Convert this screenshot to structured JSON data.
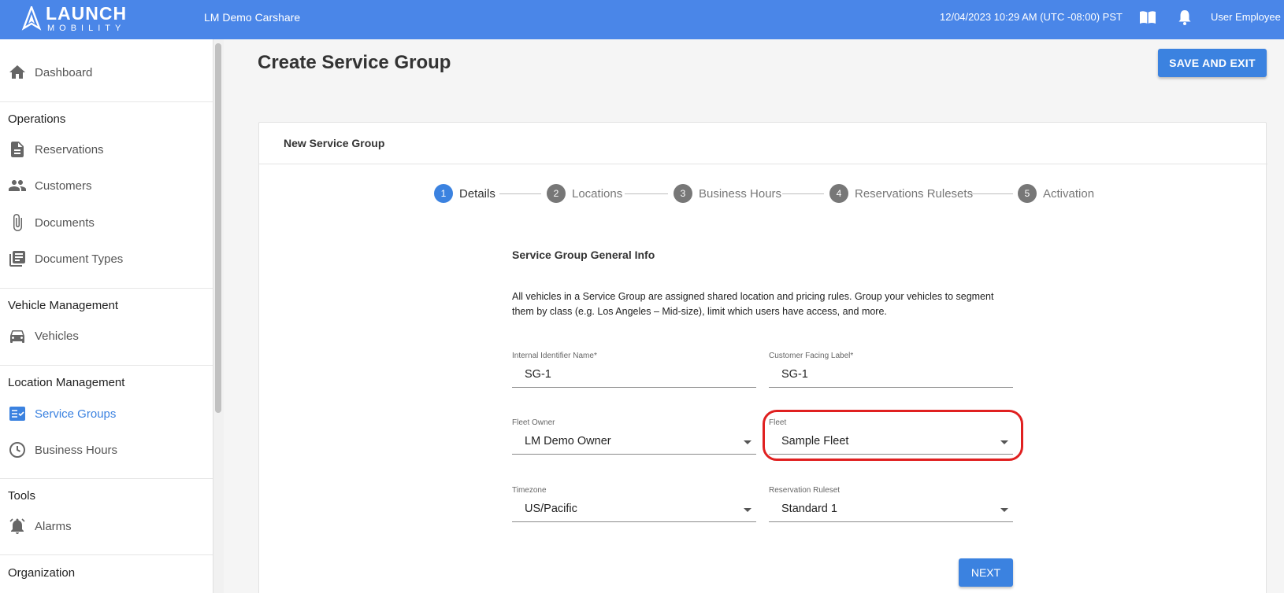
{
  "topbar": {
    "logo_word": "LAUNCH",
    "logo_sub": "MOBILITY",
    "app_name": "LM Demo Carshare",
    "datetime": "12/04/2023 10:29 AM (UTC -08:00) PST",
    "user_name": "User Employee",
    "icons": [
      "book-icon",
      "bell-icon"
    ]
  },
  "sidebar": {
    "dashboard": "Dashboard",
    "sections": {
      "operations": "Operations",
      "vehicle_management": "Vehicle Management",
      "location_management": "Location Management",
      "tools": "Tools",
      "organization": "Organization"
    },
    "items": {
      "reservations": "Reservations",
      "customers": "Customers",
      "documents": "Documents",
      "document_types": "Document Types",
      "vehicles": "Vehicles",
      "service_groups": "Service Groups",
      "business_hours": "Business Hours",
      "alarms": "Alarms"
    },
    "active_item": "Service Groups",
    "accent_color": "#3b82e0"
  },
  "main": {
    "page_title": "Create Service Group",
    "save_label": "SAVE AND EXIT",
    "card_title": "New Service Group",
    "steps": [
      {
        "num": "1",
        "label": "Details"
      },
      {
        "num": "2",
        "label": "Locations"
      },
      {
        "num": "3",
        "label": "Business Hours"
      },
      {
        "num": "4",
        "label": "Reservations Rulesets"
      },
      {
        "num": "5",
        "label": "Activation"
      }
    ],
    "active_step": 1,
    "section_title": "Service Group General Info",
    "description": "All vehicles in a Service Group are assigned shared location and pricing rules. Group your vehicles to segment them by class (e.g. Los Angeles – Mid-size), limit which users have access, and more.",
    "fields": {
      "internal_name": {
        "label": "Internal Identifier Name*",
        "value": "SG-1"
      },
      "customer_label": {
        "label": "Customer Facing Label*",
        "value": "SG-1"
      },
      "fleet_owner": {
        "label": "Fleet Owner",
        "value": "LM Demo Owner"
      },
      "fleet": {
        "label": "Fleet",
        "value": "Sample Fleet"
      },
      "timezone": {
        "label": "Timezone",
        "value": "US/Pacific"
      },
      "reservation_ruleset": {
        "label": "Reservation Ruleset",
        "value": "Standard 1"
      }
    },
    "next_label": "NEXT",
    "highlight_color": "#e02020"
  }
}
